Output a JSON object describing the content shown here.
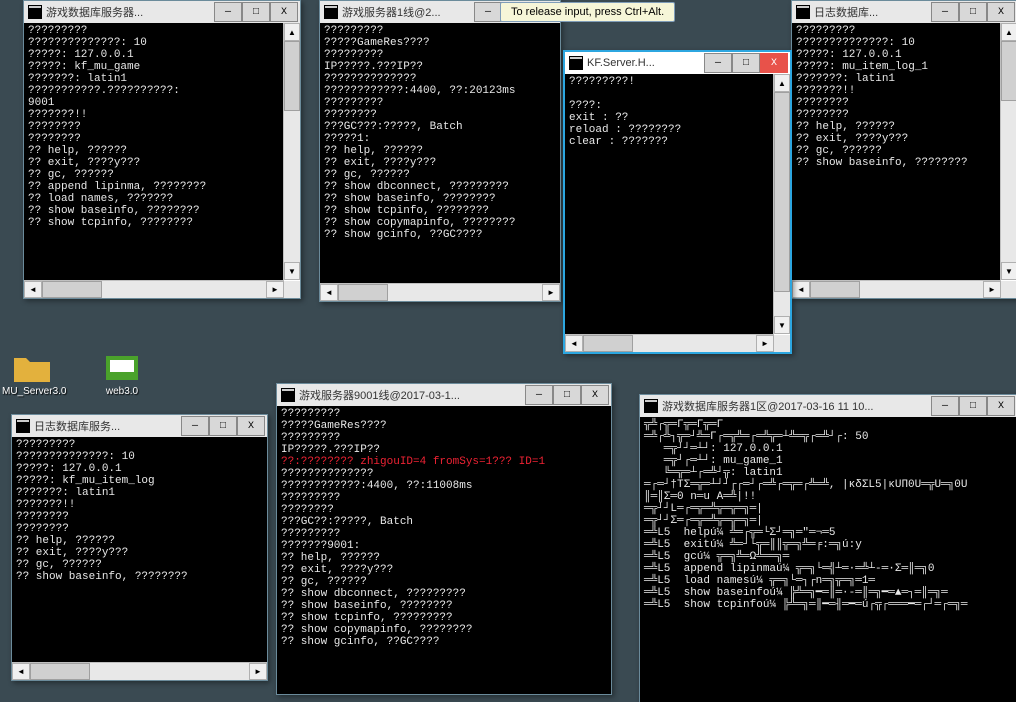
{
  "tooltip": {
    "text": "To release input, press Ctrl+Alt."
  },
  "desktop_icons": [
    {
      "label": "MU_Server3.0"
    },
    {
      "label": "web3.0"
    }
  ],
  "windows": {
    "w1": {
      "title": "游戏数据库服务器...",
      "lines": [
        "?????????",
        "??????????????: 10",
        "?????: 127.0.0.1",
        "?????: kf_mu_game",
        "???????: latin1",
        "???????????.??????????:",
        "9001",
        "???????!!",
        "????????",
        "????????",
        "?? help, ??????",
        "?? exit, ????y???",
        "?? gc, ??????",
        "?? append lipinma, ????????",
        "?? load names, ???????",
        "?? show baseinfo, ????????",
        "?? show tcpinfo, ????????"
      ]
    },
    "w2": {
      "title": "游戏服务器1线@2...",
      "lines": [
        "?????????",
        "?????GameRes????",
        "?????????",
        "IP?????.???IP??",
        "??????????????",
        "????????????:4400, ??:20123ms",
        "?????????",
        "????????",
        "???GC???:?????, Batch",
        "?????1:",
        "?? help, ??????",
        "?? exit, ????y???",
        "?? gc, ??????",
        "?? show dbconnect, ?????????",
        "?? show baseinfo, ????????",
        "?? show tcpinfo, ????????",
        "?? show copymapinfo, ????????",
        "?? show gcinfo, ??GC????"
      ]
    },
    "w3": {
      "title": "KF.Server.H...",
      "lines": [
        "?????????!",
        "",
        "????:",
        "exit : ??",
        "reload : ????????",
        "clear : ???????"
      ]
    },
    "w4": {
      "title": "日志数据库...",
      "lines": [
        "?????????",
        "??????????????: 10",
        "?????: 127.0.0.1",
        "?????: mu_item_log_1",
        "???????: latin1",
        "???????!!",
        "????????",
        "????????",
        "?? help, ??????",
        "?? exit, ????y???",
        "?? gc, ??????",
        "?? show baseinfo, ????????"
      ]
    },
    "w5": {
      "title": "日志数据库服务...",
      "lines": [
        "?????????",
        "??????????????: 10",
        "?????: 127.0.0.1",
        "?????: kf_mu_item_log",
        "???????: latin1",
        "???????!!",
        "????????",
        "????????",
        "?? help, ??????",
        "?? exit, ????y???",
        "?? gc, ??????",
        "?? show baseinfo, ????????"
      ]
    },
    "w6": {
      "title": "游戏服务器9001线@2017-03-1...",
      "lines_a": [
        "?????????",
        "?????GameRes????",
        "?????????",
        "IP?????.???IP??"
      ],
      "red_line": "??:???????? zhigouID=4 fromSys=1??? ID=1",
      "lines_b": [
        "??????????????",
        "????????????:4400, ??:11008ms",
        "?????????",
        "????????",
        "???GC??:?????, Batch",
        "?????????",
        "???????9001:",
        "?? help, ??????",
        "?? exit, ????y???",
        "?? gc, ??????",
        "?? show dbconnect, ?????????",
        "?? show baseinfo, ????????",
        "?? show tcpinfo, ?????????",
        "?? show copymapinfo, ????????",
        "?? show gcinfo, ??GC????"
      ]
    },
    "w7": {
      "title": "游戏数据库服务器1区@2017-03-16 11 10...",
      "lines": [
        "╦╩┌╦═Γ╦═Γ╦═Γ",
        "═╩┌╩┐╦═┘╩═Γ┌═╦╩═┌═╩╦═┴╩═╦┌═╩┘┌: 50",
        "   ═╦┘┘═┴┘: 127.0.0.1",
        "   ═╦┘┌═┴┘: mu_game_1",
        "   ╚═╦═┴┌═╩┘╦: latin1",
        "═┌═┘†TΣ═╦═┴┘┘┌┌═┘┌═╩┌═╦═┌╩═╩, |ĸδΣL5|ĸUП0U═╦U═╗0U",
        "║═║Σ═0 n═u A═╩|!! ",
        "═╦┘┘L═┌═╦═╩╦═╦═╗═|",
        "═╦┘┘Σ═┌═╦═╩╦═╦═╗═|",
        "═╩L5  helpú¼ ╩═┌╦═└Σ┘═╗═″═¬═5",
        "═╩L5  exitú¼ ╩═┘└╦═║║╦═╗╩═╒:═╗ú:y",
        "═╩L5  gcú¼ ╦═╗╩═Ω╩══╗═",
        "═╩L5  append lipinmaú¼ ╦═╗└═╣┴═·═╩┴-═·Σ═║═╗0",
        "═╩L5  load namesú¼ ╦═╗└═┐┌n═╗╦═╗═1═",
        "═╩L5  show baseinfoú¼ ╠╩═╗━═║═·-═║═╗━═▲═┐═║═╗═",
        "═╩L5  show tcpinfoú¼ ╠╩═╗═║━═╢═━═ú┌╦┌═══━═┌┘═┌═╗═"
      ]
    }
  },
  "buttons": {
    "min": "—",
    "max": "□",
    "close": "X"
  },
  "scroll": {
    "up": "▲",
    "down": "▼",
    "left": "◄",
    "right": "►"
  }
}
